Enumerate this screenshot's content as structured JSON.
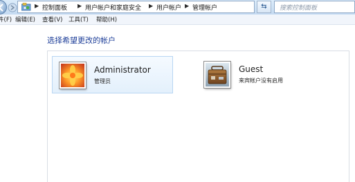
{
  "address_bar": {
    "breadcrumbs": [
      "控制面板",
      "用户帐户和家庭安全",
      "用户帐户",
      "管理帐户"
    ],
    "search_placeholder": "搜索控制面板"
  },
  "menu": {
    "items": [
      "件(F)",
      "编辑(E)",
      "查看(V)",
      "工具(T)",
      "帮助(H)"
    ]
  },
  "content": {
    "title": "选择希望更改的帐户"
  },
  "accounts": [
    {
      "name": "Administrator",
      "subtitle": "管理员",
      "icon": "flower-avatar-icon"
    },
    {
      "name": "Guest",
      "subtitle": "来宾帐户没有启用",
      "icon": "suitcase-avatar-icon"
    }
  ],
  "colors": {
    "title_blue": "#1e3f99",
    "selection_bg": "#e3f0fc",
    "selection_border": "#b8d6f3"
  }
}
